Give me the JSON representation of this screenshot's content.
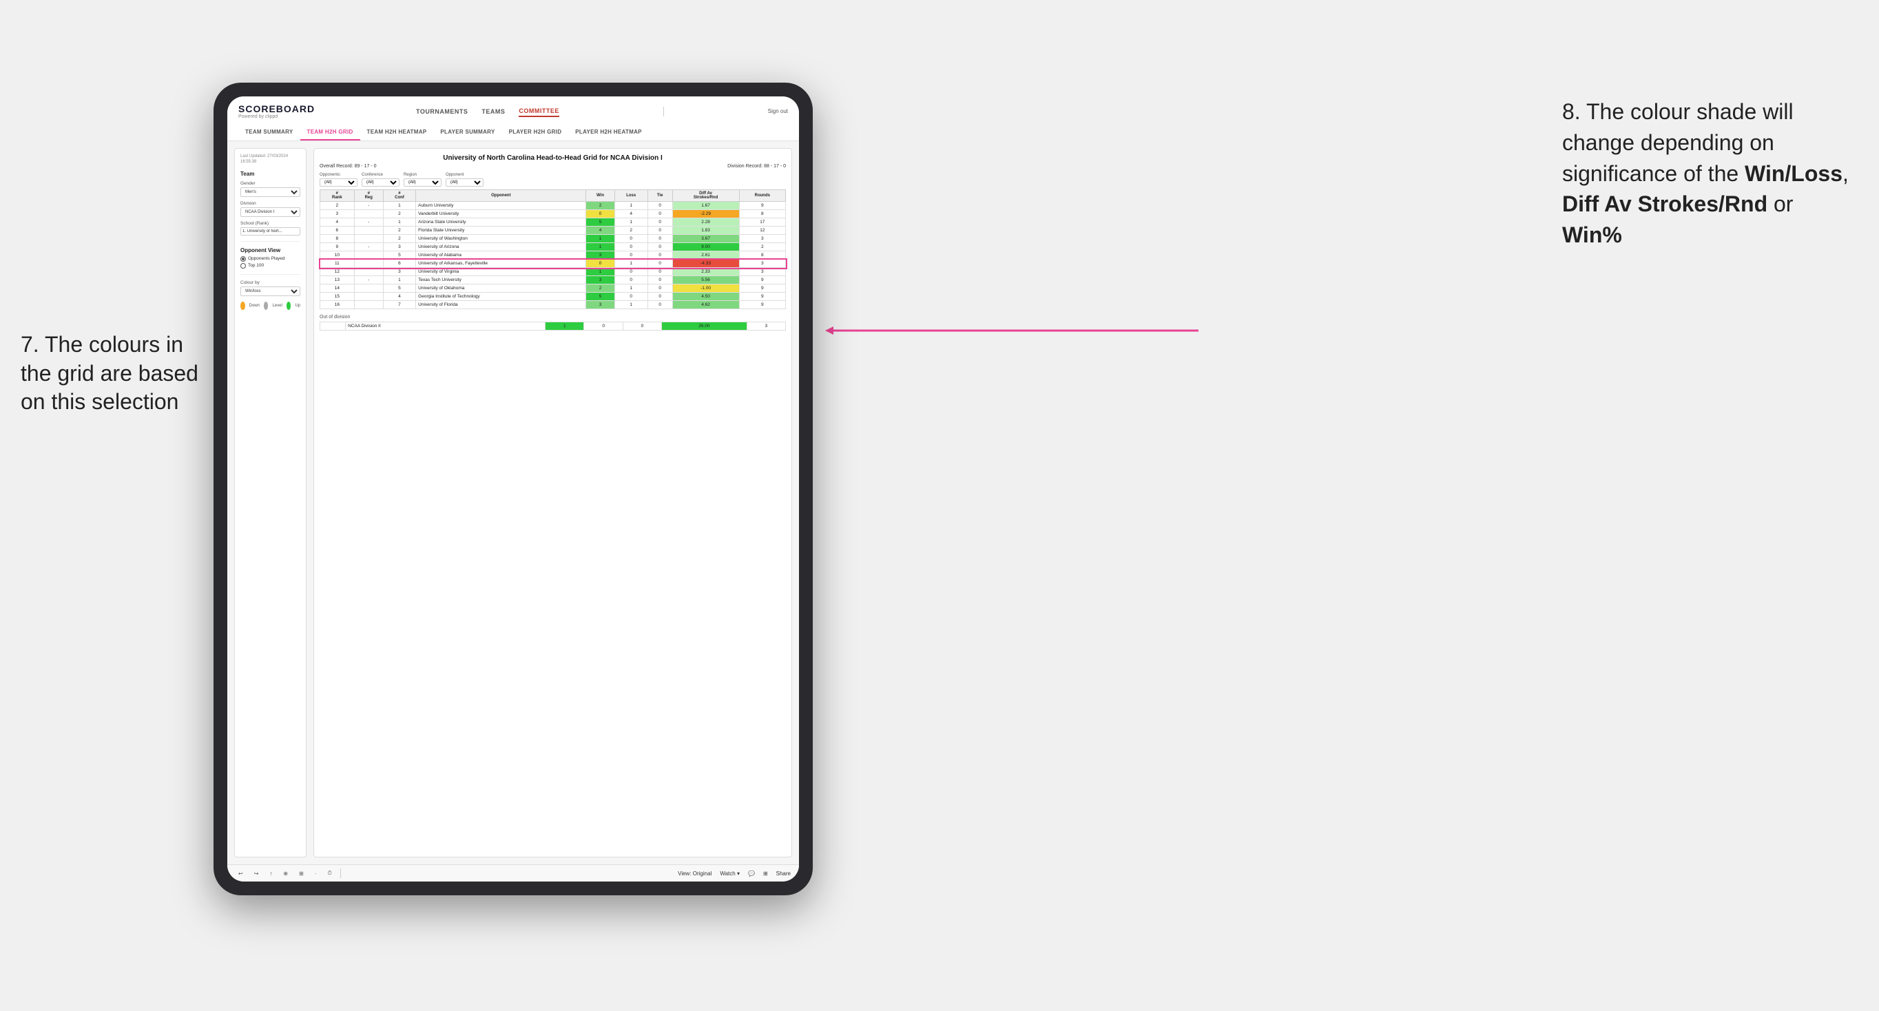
{
  "annotations": {
    "left_text": "7. The colours in the grid are based on this selection",
    "right_title": "8. The colour shade will change depending on significance of the ",
    "right_bold1": "Win/Loss",
    "right_separator1": ", ",
    "right_bold2": "Diff Av Strokes/Rnd",
    "right_separator2": " or ",
    "right_bold3": "Win%"
  },
  "header": {
    "logo": "SCOREBOARD",
    "logo_sub": "Powered by clippd",
    "nav": [
      "TOURNAMENTS",
      "TEAMS",
      "COMMITTEE"
    ],
    "sign_out": "Sign out",
    "sub_nav": [
      "TEAM SUMMARY",
      "TEAM H2H GRID",
      "TEAM H2H HEATMAP",
      "PLAYER SUMMARY",
      "PLAYER H2H GRID",
      "PLAYER H2H HEATMAP"
    ]
  },
  "left_panel": {
    "last_updated_label": "Last Updated: 27/03/2024",
    "last_updated_time": "16:55:38",
    "team_section": "Team",
    "gender_label": "Gender",
    "gender_value": "Men's",
    "division_label": "Division",
    "division_value": "NCAA Division I",
    "school_label": "School (Rank)",
    "school_value": "1. University of Nort...",
    "opponent_view_label": "Opponent View",
    "opponents_played": "Opponents Played",
    "top_100": "Top 100",
    "colour_by_label": "Colour by",
    "colour_by_value": "Win/loss",
    "legend": {
      "down_label": "Down",
      "level_label": "Level",
      "up_label": "Up"
    }
  },
  "grid": {
    "title": "University of North Carolina Head-to-Head Grid for NCAA Division I",
    "overall_record": "Overall Record: 89 - 17 - 0",
    "division_record": "Division Record: 88 - 17 - 0",
    "filters": {
      "opponents_label": "Opponents:",
      "opponents_value": "(All)",
      "conference_label": "Conference",
      "conference_value": "(All)",
      "region_label": "Region",
      "region_value": "(All)",
      "opponent_label": "Opponent",
      "opponent_value": "(All)"
    },
    "columns": [
      "#\nRank",
      "#\nReg",
      "#\nConf",
      "Opponent",
      "Win",
      "Loss",
      "Tie",
      "Diff Av\nStrokes/Rnd",
      "Rounds"
    ],
    "rows": [
      {
        "rank": "2",
        "reg": "-",
        "conf": "1",
        "opponent": "Auburn University",
        "win": "2",
        "loss": "1",
        "tie": "0",
        "diff": "1.67",
        "rounds": "9",
        "win_color": "green",
        "diff_color": "green_light"
      },
      {
        "rank": "3",
        "reg": "",
        "conf": "2",
        "opponent": "Vanderbilt University",
        "win": "0",
        "loss": "4",
        "tie": "0",
        "diff": "-2.29",
        "rounds": "8",
        "win_color": "yellow",
        "diff_color": "orange"
      },
      {
        "rank": "4",
        "reg": "-",
        "conf": "1",
        "opponent": "Arizona State University",
        "win": "5",
        "loss": "1",
        "tie": "0",
        "diff": "2.28",
        "rounds": "",
        "win_color": "green_dark",
        "diff_color": "green_light"
      },
      {
        "rank": "6",
        "reg": "",
        "conf": "2",
        "opponent": "Florida State University",
        "win": "4",
        "loss": "2",
        "tie": "0",
        "diff": "1.83",
        "rounds": "12",
        "win_color": "green",
        "diff_color": "green_light"
      },
      {
        "rank": "8",
        "reg": "",
        "conf": "2",
        "opponent": "University of Washington",
        "win": "1",
        "loss": "0",
        "tie": "0",
        "diff": "3.67",
        "rounds": "3",
        "win_color": "green_dark",
        "diff_color": "green"
      },
      {
        "rank": "9",
        "reg": "-",
        "conf": "3",
        "opponent": "University of Arizona",
        "win": "1",
        "loss": "0",
        "tie": "0",
        "diff": "9.00",
        "rounds": "2",
        "win_color": "green_dark",
        "diff_color": "green_dark"
      },
      {
        "rank": "10",
        "reg": "",
        "conf": "5",
        "opponent": "University of Alabama",
        "win": "3",
        "loss": "0",
        "tie": "0",
        "diff": "2.61",
        "rounds": "8",
        "win_color": "green_dark",
        "diff_color": "green_light"
      },
      {
        "rank": "11",
        "reg": "",
        "conf": "6",
        "opponent": "University of Arkansas, Fayetteville",
        "win": "0",
        "loss": "1",
        "tie": "0",
        "diff": "-4.33",
        "rounds": "3",
        "win_color": "yellow",
        "diff_color": "red"
      },
      {
        "rank": "12",
        "reg": "",
        "conf": "3",
        "opponent": "University of Virginia",
        "win": "1",
        "loss": "0",
        "tie": "0",
        "diff": "2.33",
        "rounds": "3",
        "win_color": "green_dark",
        "diff_color": "green_light"
      },
      {
        "rank": "13",
        "reg": "-",
        "conf": "1",
        "opponent": "Texas Tech University",
        "win": "3",
        "loss": "0",
        "tie": "0",
        "diff": "5.56",
        "rounds": "9",
        "win_color": "green_dark",
        "diff_color": "green"
      },
      {
        "rank": "14",
        "reg": "",
        "conf": "5",
        "opponent": "University of Oklahoma",
        "win": "2",
        "loss": "1",
        "tie": "0",
        "diff": "-1.00",
        "rounds": "9",
        "win_color": "green",
        "diff_color": "yellow"
      },
      {
        "rank": "15",
        "reg": "",
        "conf": "4",
        "opponent": "Georgia Institute of Technology",
        "win": "5",
        "loss": "0",
        "tie": "0",
        "diff": "4.50",
        "rounds": "9",
        "win_color": "green_dark",
        "diff_color": "green"
      },
      {
        "rank": "16",
        "reg": "",
        "conf": "7",
        "opponent": "University of Florida",
        "win": "3",
        "loss": "1",
        "tie": "0",
        "diff": "4.62",
        "rounds": "9",
        "win_color": "green",
        "diff_color": "green"
      }
    ],
    "out_of_division": {
      "label": "Out of division",
      "row": {
        "division": "NCAA Division II",
        "win": "1",
        "loss": "0",
        "tie": "0",
        "diff": "26.00",
        "rounds": "3",
        "win_color": "green_dark",
        "diff_color": "green_dark"
      }
    }
  },
  "toolbar": {
    "buttons": [
      "←",
      "→",
      "↑",
      "⊕",
      "⊞",
      "·",
      "⏱"
    ],
    "view_label": "View: Original",
    "watch_label": "Watch ▾",
    "share_label": "Share"
  }
}
